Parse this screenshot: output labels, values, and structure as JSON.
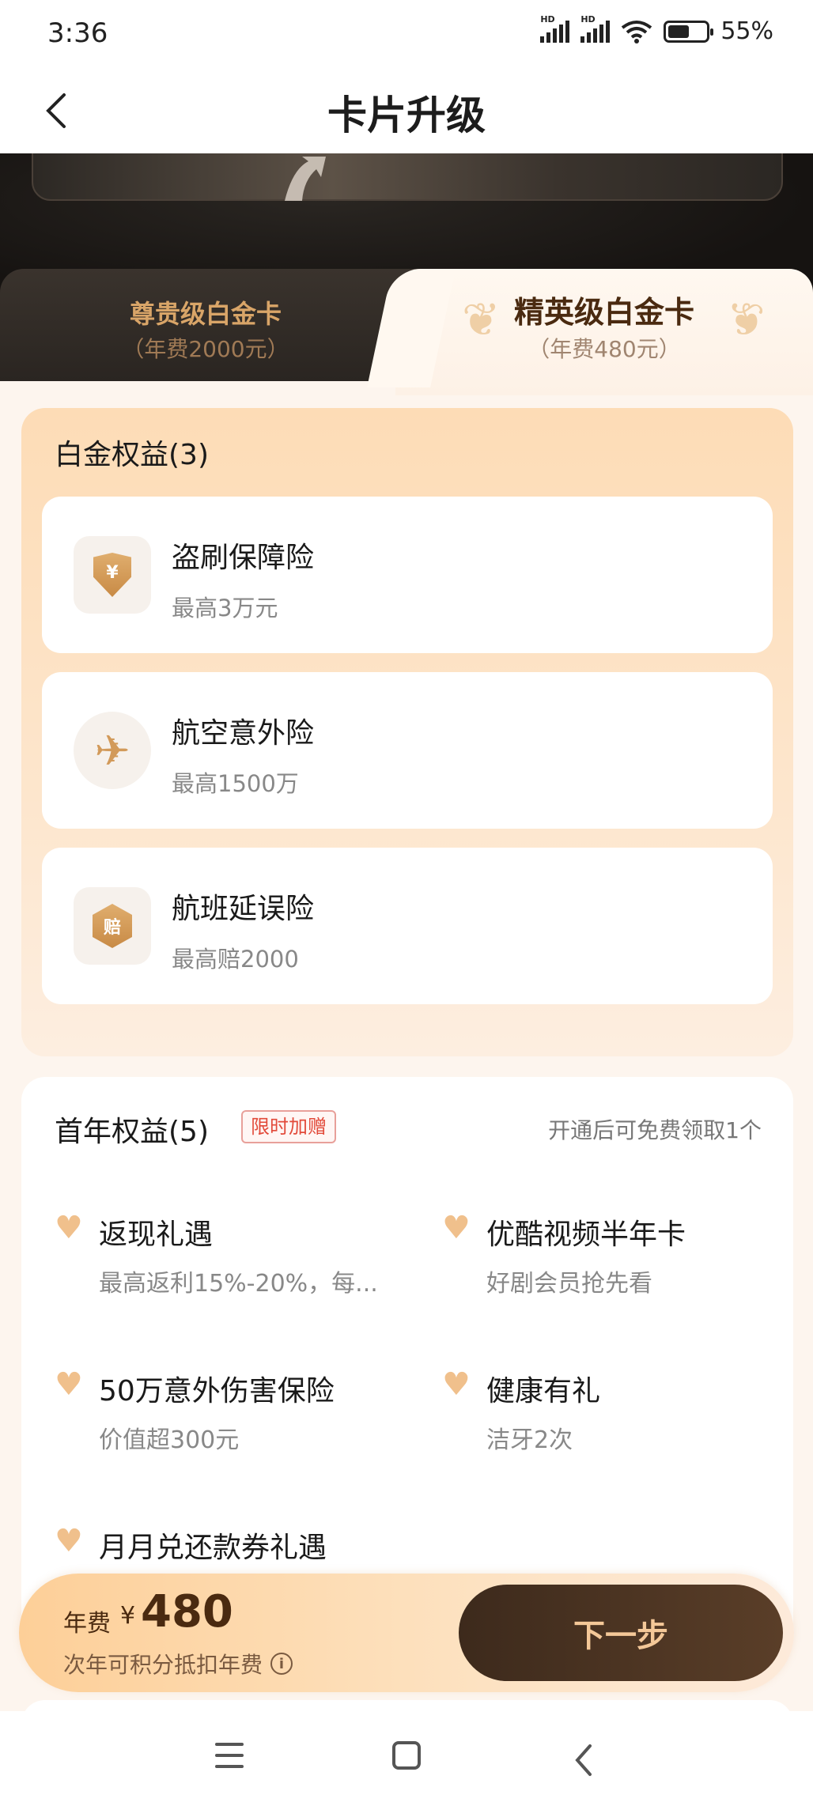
{
  "status_bar": {
    "time": "3:36",
    "signal1_tag": "HD",
    "signal2_tag": "HD",
    "battery": "55%"
  },
  "header": {
    "back_glyph": "<",
    "title": "卡片升级"
  },
  "tabs": [
    {
      "name": "尊贵级白金卡",
      "fee": "（年费2000元）",
      "selected": false
    },
    {
      "name": "精英级白金卡",
      "fee": "（年费480元）",
      "selected": true
    }
  ],
  "platinum": {
    "title": "白金权益(3)",
    "items": [
      {
        "icon": "yuan-shield-icon",
        "glyph": "¥",
        "name": "盗刷保障险",
        "desc": "最高3万元"
      },
      {
        "icon": "airplane-icon",
        "glyph": "✈",
        "name": "航空意外险",
        "desc": "最高1500万"
      },
      {
        "icon": "compensation-hex-icon",
        "glyph": "赔",
        "name": "航班延误险",
        "desc": "最高赔2000"
      }
    ]
  },
  "first_year": {
    "title": "首年权益(5)",
    "badge": "限时加赠",
    "note": "开通后可免费领取1个",
    "items": [
      {
        "name": "返现礼遇",
        "desc": "最高返利15%-20%，每..."
      },
      {
        "name": "优酷视频半年卡",
        "desc": "好剧会员抢先看"
      },
      {
        "name": "50万意外伤害保险",
        "desc": "价值超300元"
      },
      {
        "name": "健康有礼",
        "desc": "洁牙2次"
      },
      {
        "name": "月月兑还款券礼遇",
        "desc": ""
      }
    ]
  },
  "pay_bar": {
    "fee_label": "年费",
    "currency": "¥",
    "amount": "480",
    "note": "次年可积分抵扣年费",
    "info_glyph": "i",
    "button": "下一步"
  },
  "colors": {
    "accent_gold": "#d29a5a",
    "button_brown": "#3d2a1c",
    "badge_red": "#e24a3a"
  }
}
